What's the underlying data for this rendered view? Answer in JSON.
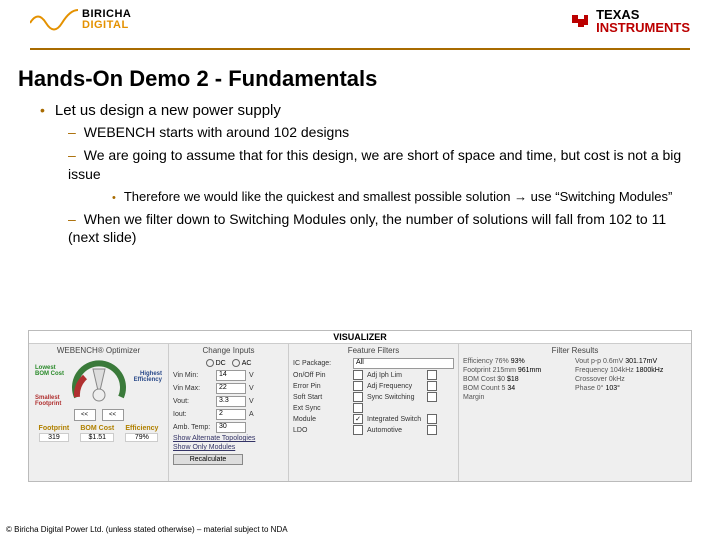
{
  "brand": {
    "top": "BIRICHA",
    "bottom": "DIGITAL"
  },
  "ti": {
    "top": "TEXAS",
    "bottom": "INSTRUMENTS"
  },
  "slide_title": "Hands-On Demo 2 - Fundamentals",
  "bullets": {
    "l1": "Let us design a new power supply",
    "l2a": "WEBENCH starts with around 102 designs",
    "l2b": "We are going to assume that for this design, we are short of space and time, but cost is not a big issue",
    "l3a": "Therefore we would like the quickest and smallest possible solution → use “Switching Modules”",
    "l2c": "When we filter down to Switching Modules only, the number of solutions will fall from 102 to 11 (next slide)"
  },
  "visualizer": {
    "title": "VISUALIZER",
    "optimizer": {
      "title": "WEBENCH® Optimizer",
      "lowest_cost": "Lowest BOM Cost",
      "smallest": "Smallest Footprint",
      "highest": "Highest Efficiency",
      "metrics": {
        "footprint_h": "Footprint",
        "footprint_v": "319",
        "bom_h": "BOM Cost",
        "bom_v": "$1.51",
        "eff_h": "Efficiency",
        "eff_v": "79%"
      }
    },
    "inputs": {
      "title": "Change Inputs",
      "dc": "DC",
      "ac": "AC",
      "vinmin_l": "Vin Min:",
      "vinmin_v": "14",
      "vinmax_l": "Vin Max:",
      "vinmax_v": "22",
      "vout_l": "Vout:",
      "vout_v": "3.3",
      "iout_l": "Iout:",
      "iout_v": "2",
      "temp_l": "Amb. Temp:",
      "temp_v": "30",
      "unit_v": "V",
      "unit_a": "A",
      "link1": "Show Alternate Topologies",
      "link2": "Show Only Modules",
      "recalc": "Recalculate"
    },
    "features": {
      "title": "Feature Filters",
      "rows": [
        {
          "lbl": "IC Package:",
          "type": "sel",
          "val": "All"
        },
        {
          "lbl": "On/Off Pin",
          "type": "chk",
          "on": false,
          "extra": "Adj Iph Lim"
        },
        {
          "lbl": "Error Pin",
          "type": "chk",
          "on": false,
          "extra": "Adj Frequency"
        },
        {
          "lbl": "Soft Start",
          "type": "chk",
          "on": false,
          "extra": "Sync Switching"
        },
        {
          "lbl": "Ext Sync",
          "type": "chk",
          "on": false
        },
        {
          "lbl": "Module",
          "type": "chk",
          "on": true,
          "extra": "Integrated Switch"
        },
        {
          "lbl": "LDO",
          "type": "chk",
          "on": false,
          "extra": "Automotive"
        }
      ]
    },
    "results": {
      "title": "Filter Results",
      "items": [
        {
          "lab": "Efficiency 76%",
          "right": "93%"
        },
        {
          "lab": "Vout p-p 0.6mV",
          "right": "301.17mV"
        },
        {
          "lab": "Footprint 215mm",
          "right": "961mm"
        },
        {
          "lab": "Frequency 104kHz",
          "right": "1800kHz"
        },
        {
          "lab": "BOM Cost $0",
          "right": "$18"
        },
        {
          "lab": "Crossover 0kHz",
          "right": ""
        },
        {
          "lab": "BOM Count 5",
          "right": "34"
        },
        {
          "lab": "Phase 0°",
          "right": "103°"
        },
        {
          "lab": "Margin",
          "right": ""
        }
      ]
    }
  },
  "footer": "© Biricha Digital Power Ltd. (unless stated otherwise) – material subject to NDA"
}
